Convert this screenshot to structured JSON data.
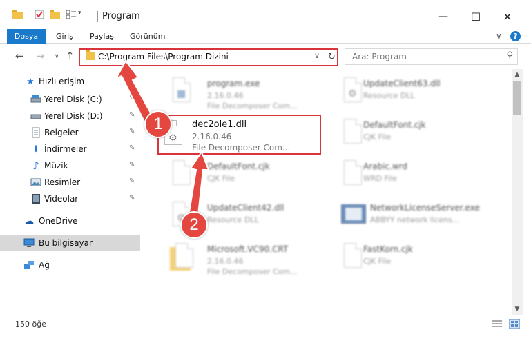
{
  "window": {
    "title": "Program",
    "minimize_glyph": "—",
    "maximize_glyph": "☐",
    "close_glyph": "✕"
  },
  "ribbon": {
    "tabs": [
      {
        "label": "Dosya",
        "active": true
      },
      {
        "label": "Giriş",
        "active": false
      },
      {
        "label": "Paylaş",
        "active": false
      },
      {
        "label": "Görünüm",
        "active": false
      }
    ],
    "expand_glyph": "∨",
    "help_glyph": "?"
  },
  "nav": {
    "back_glyph": "←",
    "forward_glyph": "→",
    "recent_glyph": "∨",
    "up_glyph": "↑"
  },
  "address": {
    "path": "C:\\Program Files\\Program Dizini",
    "dropdown_glyph": "∨",
    "refresh_glyph": "↻"
  },
  "search": {
    "placeholder": "Ara: Program",
    "icon_glyph": "⚲"
  },
  "sidebar": {
    "items": [
      {
        "label": "Hızlı erişim",
        "icon": "star-icon",
        "glyph": "★",
        "color": "#2a7ad5",
        "pinned": false
      },
      {
        "label": "Yerel Disk (C:)",
        "icon": "drive-icon",
        "glyph": "▬",
        "color": "#6a7a8a",
        "pinned": true
      },
      {
        "label": "Yerel Disk (D:)",
        "icon": "drive-icon",
        "glyph": "▬",
        "color": "#6a7a8a",
        "pinned": true
      },
      {
        "label": "Belgeler",
        "icon": "documents-icon",
        "glyph": "▤",
        "color": "#7a8a9a",
        "pinned": true
      },
      {
        "label": "İndirmeler",
        "icon": "download-icon",
        "glyph": "⬇",
        "color": "#2a7ad5",
        "pinned": true
      },
      {
        "label": "Müzik",
        "icon": "music-icon",
        "glyph": "♪",
        "color": "#2a7ad5",
        "pinned": true
      },
      {
        "label": "Resimler",
        "icon": "pictures-icon",
        "glyph": "▣",
        "color": "#4a8ab5",
        "pinned": true
      },
      {
        "label": "Videolar",
        "icon": "video-icon",
        "glyph": "▦",
        "color": "#3a4a5a",
        "pinned": true
      },
      {
        "label": "OneDrive",
        "icon": "onedrive-icon",
        "glyph": "☁",
        "color": "#1a5aaa",
        "pinned": false
      },
      {
        "label": "Bu bilgisayar",
        "icon": "computer-icon",
        "glyph": "▭",
        "color": "#2a7ad5",
        "pinned": false,
        "selected": true
      },
      {
        "label": "Ağ",
        "icon": "network-icon",
        "glyph": "⊞",
        "color": "#2a7ad5",
        "pinned": false
      }
    ],
    "pin_glyph": "📌"
  },
  "files": [
    {
      "name": "program.exe",
      "line2": "2.16.0.46",
      "line3": "File Decomposer Com...",
      "icon": "exe-icon",
      "blurred": true
    },
    {
      "name": "UpdateClient63.dll",
      "line2": "Resource DLL",
      "line3": "",
      "icon": "dll-icon",
      "blurred": true
    },
    {
      "name": "dec2ole1.dll",
      "line2": "2.16.0.46",
      "line3": "File Decomposer Com...",
      "icon": "dll-icon",
      "blurred": false
    },
    {
      "name": "DefaultFont.cjk",
      "line2": "CJK File",
      "line3": "",
      "icon": "file-icon",
      "blurred": true
    },
    {
      "name": "DefaultFont.cjk",
      "line2": "CJK File",
      "line3": "",
      "icon": "file-icon",
      "blurred": true
    },
    {
      "name": "Arabic.wrd",
      "line2": "WRD File",
      "line3": "",
      "icon": "file-icon",
      "blurred": true
    },
    {
      "name": "UpdateClient42.dll",
      "line2": "Resource DLL",
      "line3": "",
      "icon": "dll-icon",
      "blurred": true
    },
    {
      "name": "NetworkLicenseServer.exe",
      "line2": "ABBYY network licens...",
      "line3": "",
      "icon": "network-exe-icon",
      "blurred": true
    },
    {
      "name": "Microsoft.VC90.CRT",
      "line2": "2.16.0.46",
      "line3": "File Decomposer Com...",
      "icon": "folder-doc-icon",
      "blurred": true
    },
    {
      "name": "FastKorn.cjk",
      "line2": "CJK File",
      "line3": "",
      "icon": "file-icon",
      "blurred": true
    }
  ],
  "status": {
    "item_count": "150 öğe"
  },
  "annotations": {
    "step1": "1",
    "step2": "2"
  },
  "colors": {
    "accent": "#1979ca",
    "highlight": "#d9343c",
    "badge": "#e4473f"
  }
}
